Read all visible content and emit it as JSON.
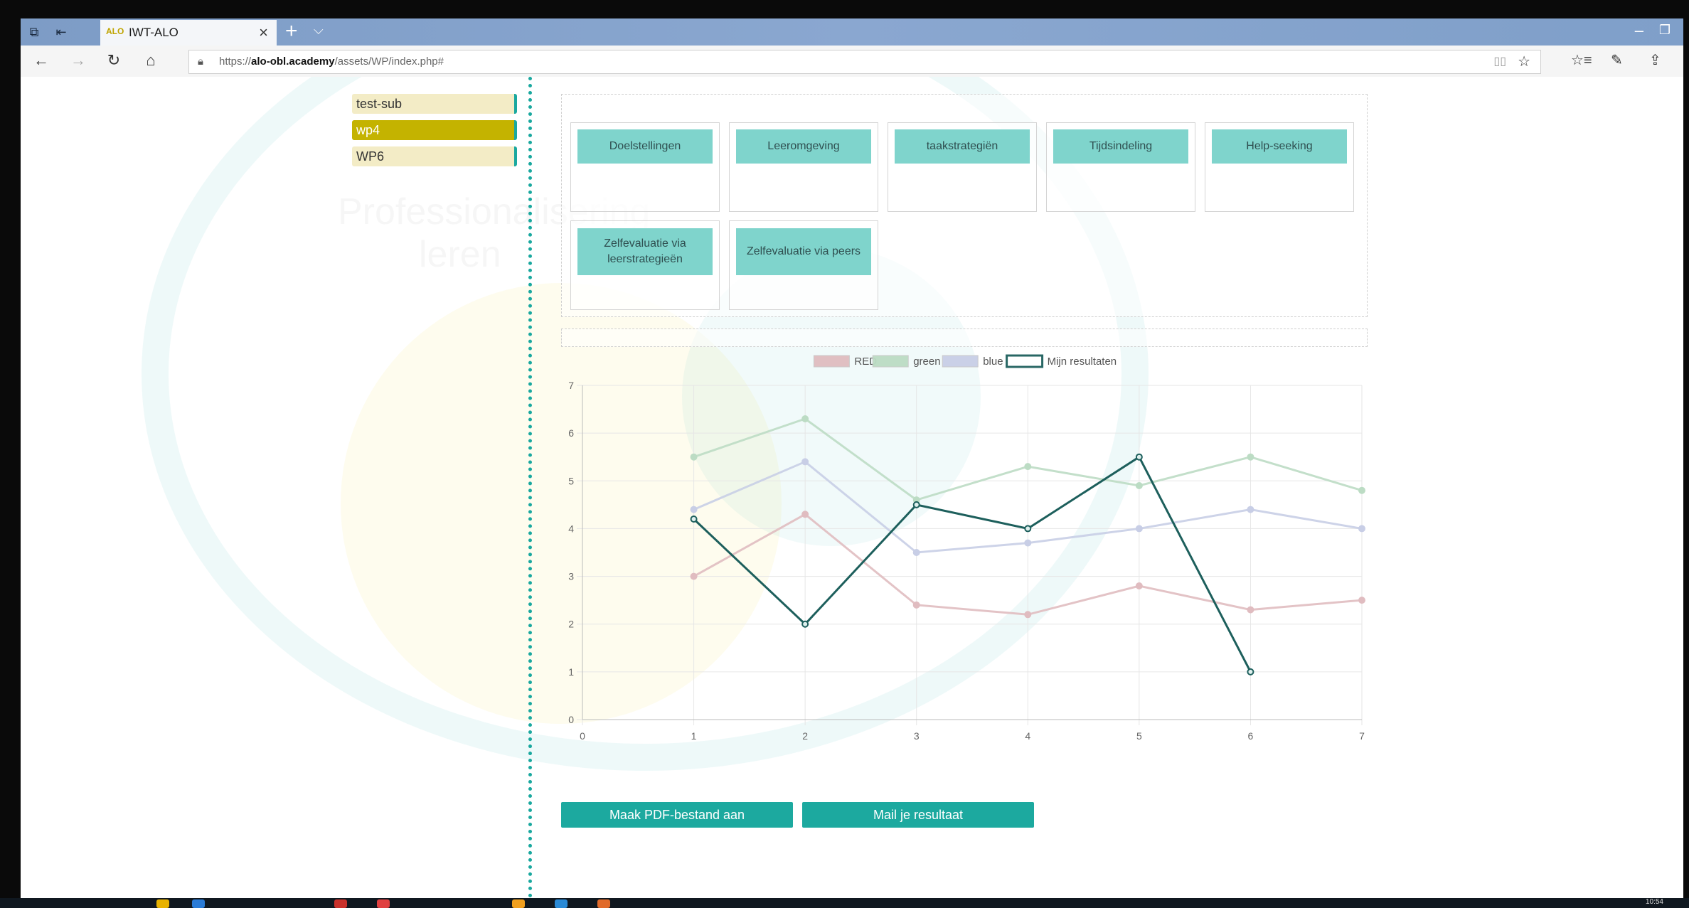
{
  "browser": {
    "tab_title": "IWT-ALO",
    "tab_favicon": "ALO",
    "tab_close": "×",
    "new_tab": "+",
    "tab_dropdown": "⌵",
    "url_prefix": "https://",
    "url_domain": "alo-obl.academy",
    "url_path": "/assets/WP/index.php#",
    "icons": [
      "back-arrow-icon",
      "forward-arrow-icon",
      "refresh-icon",
      "home-icon",
      "lock-icon",
      "reading-view-icon",
      "favorite-star-icon",
      "favorites-bar-icon",
      "pen-icon",
      "share-icon"
    ]
  },
  "sidebar": {
    "items": [
      {
        "label": "test-sub",
        "active": false
      },
      {
        "label": "wp4",
        "active": true
      },
      {
        "label": "WP6",
        "active": false
      }
    ]
  },
  "cards": [
    {
      "label": "Doelstellingen"
    },
    {
      "label": "Leeromgeving"
    },
    {
      "label": "taakstrategiën"
    },
    {
      "label": "Tijdsindeling"
    },
    {
      "label": "Help-seeking"
    },
    {
      "label": "Zelfevaluatie via leerstrategieën"
    },
    {
      "label": "Zelfevaluatie via peers"
    }
  ],
  "actions": {
    "pdf_label": "Maak PDF-bestand aan",
    "mail_label": "Mail je resultaat"
  },
  "colors": {
    "accent": "#1ca99f",
    "card": "#7fd4cc",
    "sidebar_active": "#c4b300",
    "sidebar_item": "#f3ecc6",
    "my_results": "#1d5f5c"
  },
  "taskbar": {
    "clock": "10:54"
  },
  "chart_data": {
    "type": "line",
    "x": [
      1,
      2,
      3,
      4,
      5,
      6,
      7
    ],
    "xlim": [
      0,
      7
    ],
    "ylim": [
      0,
      7
    ],
    "xticks": [
      0,
      1,
      2,
      3,
      4,
      5,
      6,
      7
    ],
    "yticks": [
      0,
      1,
      2,
      3,
      4,
      5,
      6,
      7
    ],
    "grid": true,
    "legend_position": "top-center",
    "series": [
      {
        "name": "RED",
        "color": "#e0bcc0",
        "values": [
          3.0,
          4.3,
          2.4,
          2.2,
          2.8,
          2.3,
          2.5
        ]
      },
      {
        "name": "green",
        "color": "#bcdcc4",
        "values": [
          5.5,
          6.3,
          4.6,
          5.3,
          4.9,
          5.5,
          4.8
        ]
      },
      {
        "name": "blue",
        "color": "#c8cee6",
        "values": [
          4.4,
          5.4,
          3.5,
          3.7,
          4.0,
          4.4,
          4.0
        ]
      },
      {
        "name": "Mijn resultaten",
        "color": "#1d5f5c",
        "values": [
          4.2,
          2.0,
          4.5,
          4.0,
          5.5,
          1.0,
          null
        ]
      }
    ]
  }
}
